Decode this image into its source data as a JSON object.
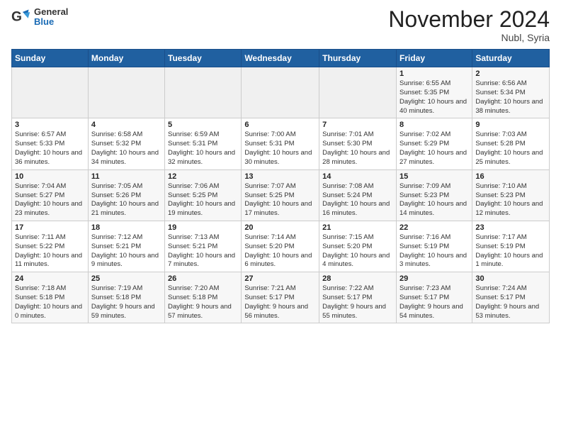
{
  "header": {
    "logo_general": "General",
    "logo_blue": "Blue",
    "title": "November 2024",
    "location": "Nubl, Syria"
  },
  "weekdays": [
    "Sunday",
    "Monday",
    "Tuesday",
    "Wednesday",
    "Thursday",
    "Friday",
    "Saturday"
  ],
  "weeks": [
    [
      {
        "day": "",
        "info": ""
      },
      {
        "day": "",
        "info": ""
      },
      {
        "day": "",
        "info": ""
      },
      {
        "day": "",
        "info": ""
      },
      {
        "day": "",
        "info": ""
      },
      {
        "day": "1",
        "info": "Sunrise: 6:55 AM\nSunset: 5:35 PM\nDaylight: 10 hours and 40 minutes."
      },
      {
        "day": "2",
        "info": "Sunrise: 6:56 AM\nSunset: 5:34 PM\nDaylight: 10 hours and 38 minutes."
      }
    ],
    [
      {
        "day": "3",
        "info": "Sunrise: 6:57 AM\nSunset: 5:33 PM\nDaylight: 10 hours and 36 minutes."
      },
      {
        "day": "4",
        "info": "Sunrise: 6:58 AM\nSunset: 5:32 PM\nDaylight: 10 hours and 34 minutes."
      },
      {
        "day": "5",
        "info": "Sunrise: 6:59 AM\nSunset: 5:31 PM\nDaylight: 10 hours and 32 minutes."
      },
      {
        "day": "6",
        "info": "Sunrise: 7:00 AM\nSunset: 5:31 PM\nDaylight: 10 hours and 30 minutes."
      },
      {
        "day": "7",
        "info": "Sunrise: 7:01 AM\nSunset: 5:30 PM\nDaylight: 10 hours and 28 minutes."
      },
      {
        "day": "8",
        "info": "Sunrise: 7:02 AM\nSunset: 5:29 PM\nDaylight: 10 hours and 27 minutes."
      },
      {
        "day": "9",
        "info": "Sunrise: 7:03 AM\nSunset: 5:28 PM\nDaylight: 10 hours and 25 minutes."
      }
    ],
    [
      {
        "day": "10",
        "info": "Sunrise: 7:04 AM\nSunset: 5:27 PM\nDaylight: 10 hours and 23 minutes."
      },
      {
        "day": "11",
        "info": "Sunrise: 7:05 AM\nSunset: 5:26 PM\nDaylight: 10 hours and 21 minutes."
      },
      {
        "day": "12",
        "info": "Sunrise: 7:06 AM\nSunset: 5:25 PM\nDaylight: 10 hours and 19 minutes."
      },
      {
        "day": "13",
        "info": "Sunrise: 7:07 AM\nSunset: 5:25 PM\nDaylight: 10 hours and 17 minutes."
      },
      {
        "day": "14",
        "info": "Sunrise: 7:08 AM\nSunset: 5:24 PM\nDaylight: 10 hours and 16 minutes."
      },
      {
        "day": "15",
        "info": "Sunrise: 7:09 AM\nSunset: 5:23 PM\nDaylight: 10 hours and 14 minutes."
      },
      {
        "day": "16",
        "info": "Sunrise: 7:10 AM\nSunset: 5:23 PM\nDaylight: 10 hours and 12 minutes."
      }
    ],
    [
      {
        "day": "17",
        "info": "Sunrise: 7:11 AM\nSunset: 5:22 PM\nDaylight: 10 hours and 11 minutes."
      },
      {
        "day": "18",
        "info": "Sunrise: 7:12 AM\nSunset: 5:21 PM\nDaylight: 10 hours and 9 minutes."
      },
      {
        "day": "19",
        "info": "Sunrise: 7:13 AM\nSunset: 5:21 PM\nDaylight: 10 hours and 7 minutes."
      },
      {
        "day": "20",
        "info": "Sunrise: 7:14 AM\nSunset: 5:20 PM\nDaylight: 10 hours and 6 minutes."
      },
      {
        "day": "21",
        "info": "Sunrise: 7:15 AM\nSunset: 5:20 PM\nDaylight: 10 hours and 4 minutes."
      },
      {
        "day": "22",
        "info": "Sunrise: 7:16 AM\nSunset: 5:19 PM\nDaylight: 10 hours and 3 minutes."
      },
      {
        "day": "23",
        "info": "Sunrise: 7:17 AM\nSunset: 5:19 PM\nDaylight: 10 hours and 1 minute."
      }
    ],
    [
      {
        "day": "24",
        "info": "Sunrise: 7:18 AM\nSunset: 5:18 PM\nDaylight: 10 hours and 0 minutes."
      },
      {
        "day": "25",
        "info": "Sunrise: 7:19 AM\nSunset: 5:18 PM\nDaylight: 9 hours and 59 minutes."
      },
      {
        "day": "26",
        "info": "Sunrise: 7:20 AM\nSunset: 5:18 PM\nDaylight: 9 hours and 57 minutes."
      },
      {
        "day": "27",
        "info": "Sunrise: 7:21 AM\nSunset: 5:17 PM\nDaylight: 9 hours and 56 minutes."
      },
      {
        "day": "28",
        "info": "Sunrise: 7:22 AM\nSunset: 5:17 PM\nDaylight: 9 hours and 55 minutes."
      },
      {
        "day": "29",
        "info": "Sunrise: 7:23 AM\nSunset: 5:17 PM\nDaylight: 9 hours and 54 minutes."
      },
      {
        "day": "30",
        "info": "Sunrise: 7:24 AM\nSunset: 5:17 PM\nDaylight: 9 hours and 53 minutes."
      }
    ]
  ]
}
